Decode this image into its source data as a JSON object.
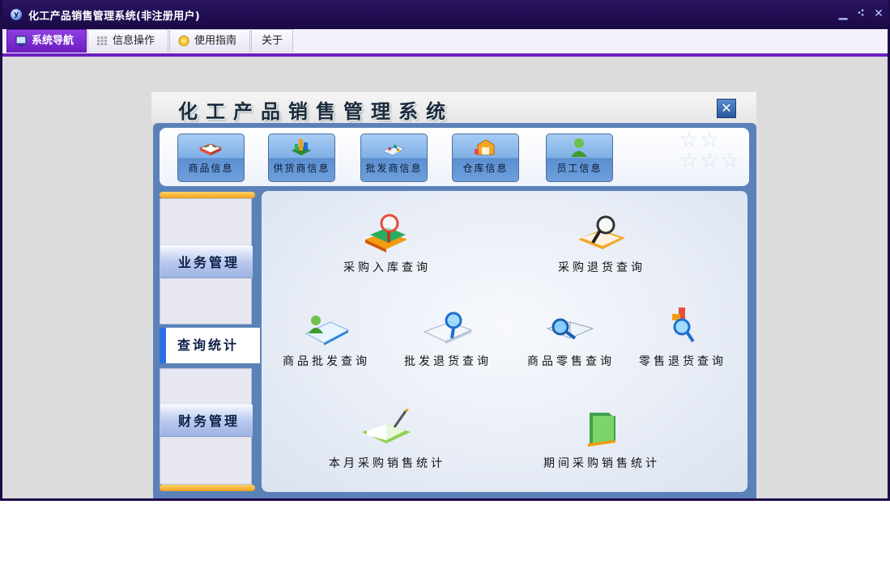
{
  "window": {
    "title": "化工产品销售管理系统(非注册用户)"
  },
  "window_buttons": {
    "minimize": "▁",
    "restore": "⁖",
    "close": "✕"
  },
  "menu": {
    "tabs": [
      {
        "label": "系统导航",
        "active": true
      },
      {
        "label": "信息操作",
        "active": false
      },
      {
        "label": "使用指南",
        "active": false
      },
      {
        "label": "关于",
        "active": false
      }
    ]
  },
  "panel": {
    "title": "化工产品销售管理系统",
    "close_label": "✕"
  },
  "toolbar": {
    "buttons": [
      {
        "label": "商品信息",
        "icon": "book-icon"
      },
      {
        "label": "供货商信息",
        "icon": "chart-icon"
      },
      {
        "label": "批发商信息",
        "icon": "network-icon"
      },
      {
        "label": "仓库信息",
        "icon": "warehouse-icon"
      },
      {
        "label": "员工信息",
        "icon": "person-icon"
      }
    ]
  },
  "sidebar": {
    "sections": [
      {
        "label": "业务管理"
      },
      {
        "label": "查询统计",
        "active": true
      },
      {
        "label": "财务管理"
      }
    ]
  },
  "queries": [
    {
      "label": "采购入库查询",
      "icon": "books-magnifier-icon"
    },
    {
      "label": "采购退货查询",
      "icon": "book-magnifier-icon"
    },
    {
      "label": "商品批发查询",
      "icon": "document-person-icon"
    },
    {
      "label": "批发退货查询",
      "icon": "blue-magnifier-icon"
    },
    {
      "label": "商品零售查询",
      "icon": "openbook-magnifier-icon"
    },
    {
      "label": "零售退货查询",
      "icon": "colorful-magnifier-icon"
    },
    {
      "label": "本月采购销售统计",
      "icon": "green-book-pen-icon"
    },
    {
      "label": "期间采购销售统计",
      "icon": "green-folder-icon"
    }
  ],
  "colors": {
    "title_bar": "#1d0b4a",
    "accent": "#6b1fbf",
    "frame": "#5b82b8"
  }
}
